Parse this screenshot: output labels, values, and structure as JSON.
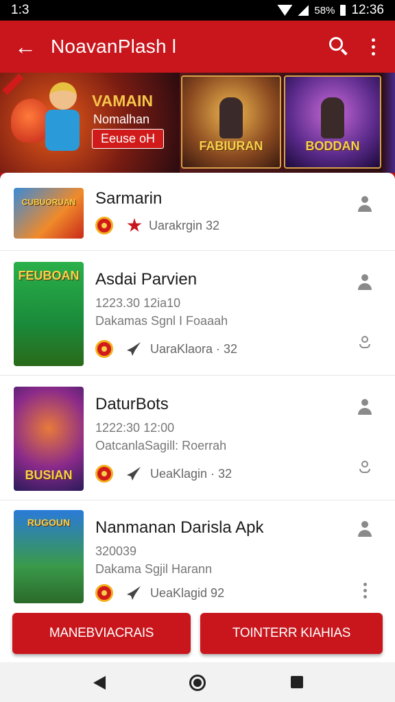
{
  "status": {
    "time_left": "1:3",
    "battery": "58%",
    "clock": "12:36"
  },
  "app_bar": {
    "title": "NoavanPlash l"
  },
  "banner": {
    "headline": "VAMAIN",
    "subtitle": "Nomalhan",
    "cta": "Eeuse oH",
    "poster1": "FABIURAN",
    "poster2": "BODDAN"
  },
  "rows": [
    {
      "title": "Sarmarin",
      "line1": "",
      "line2": "",
      "info": "Uarakrgin  32"
    },
    {
      "title": "Asdai Parvien",
      "line1": "1223.30   12ia10",
      "line2": "Dakamas Sgnl I Foaaah",
      "info": "UaraKlaora · 32"
    },
    {
      "title": "DaturBots",
      "line1": "1222:30   12:00",
      "line2": "OatcanlaSagill: Roerrah",
      "info": "UeaKlagin · 32"
    },
    {
      "title": "Nanmanan Darisla Apk",
      "line1": "320039",
      "line2": "Dakama Sgjil Harann",
      "info": "UeaKlagid  92"
    }
  ],
  "thumbs": [
    "CUBUORUAN",
    "FEUBOAN",
    "BUSIAN",
    "RUGOUN"
  ],
  "buttons": {
    "left": "MANEBVIACRAIS",
    "right": "TOINTERR KIAHIAS"
  },
  "colors": {
    "primary": "#c8161c",
    "accent": "#f2b01e"
  }
}
